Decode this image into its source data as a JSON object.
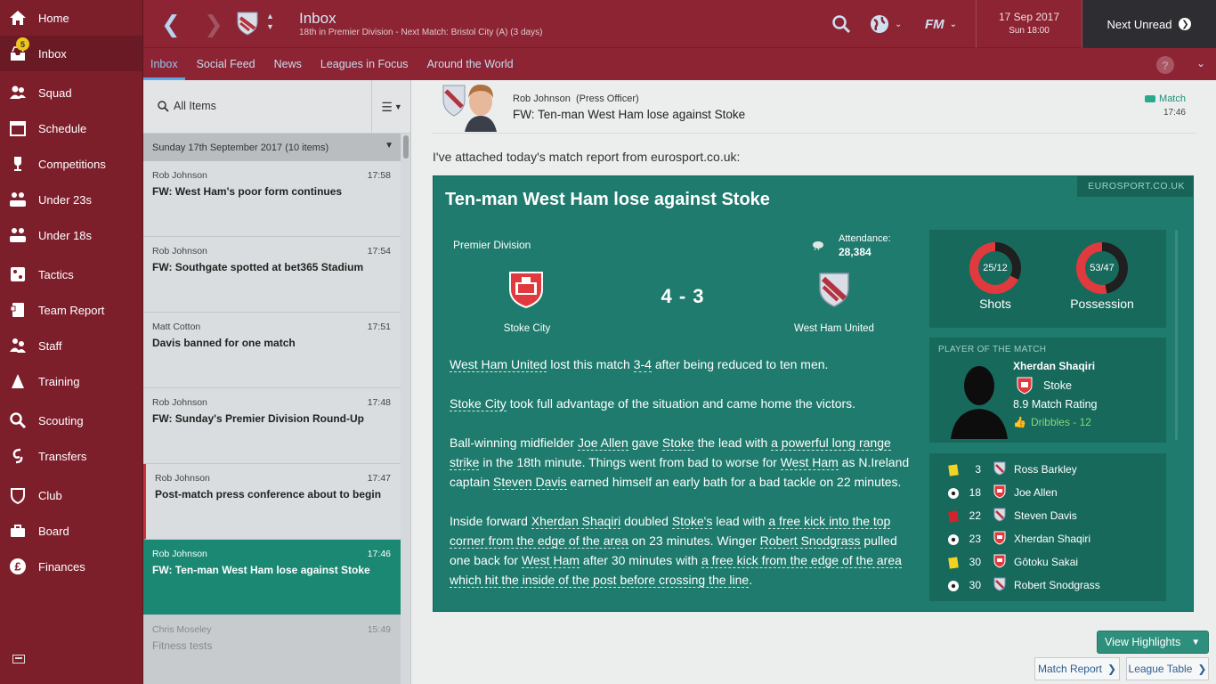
{
  "sidebar": {
    "items": [
      {
        "label": "Home",
        "icon": "home-icon"
      },
      {
        "label": "Inbox",
        "icon": "inbox-icon",
        "badge": "5",
        "active": true
      },
      {
        "label": "Squad",
        "icon": "squad-icon"
      },
      {
        "label": "Schedule",
        "icon": "calendar-icon"
      },
      {
        "label": "Competitions",
        "icon": "trophy-icon"
      },
      {
        "label": "Under 23s",
        "icon": "u23-icon"
      },
      {
        "label": "Under 18s",
        "icon": "u18-icon"
      },
      {
        "label": "Tactics",
        "icon": "tactics-icon"
      },
      {
        "label": "Team Report",
        "icon": "report-icon"
      },
      {
        "label": "Staff",
        "icon": "staff-icon"
      },
      {
        "label": "Training",
        "icon": "training-icon"
      },
      {
        "label": "Scouting",
        "icon": "search-icon"
      },
      {
        "label": "Transfers",
        "icon": "transfers-icon"
      },
      {
        "label": "Club",
        "icon": "club-icon"
      },
      {
        "label": "Board",
        "icon": "board-icon"
      },
      {
        "label": "Finances",
        "icon": "pound-icon"
      }
    ]
  },
  "header": {
    "title": "Inbox",
    "subtitle": "18th in Premier Division - Next Match: Bristol City (A) (3 days)",
    "date": "17 Sep 2017",
    "time": "Sun 18:00",
    "next_unread": "Next Unread",
    "fm_label": "FM"
  },
  "tabs": [
    {
      "label": "Inbox",
      "active": true
    },
    {
      "label": "Social Feed"
    },
    {
      "label": "News"
    },
    {
      "label": "Leagues in Focus"
    },
    {
      "label": "Around the World"
    }
  ],
  "help_label": "?",
  "list": {
    "filter_label": "All Items",
    "group_label": "Sunday 17th September 2017 (10 items)",
    "messages": [
      {
        "from": "Rob Johnson",
        "time": "17:58",
        "subject": "FW: West Ham's poor form continues"
      },
      {
        "from": "Rob Johnson",
        "time": "17:54",
        "subject": "FW: Southgate spotted at bet365 Stadium"
      },
      {
        "from": "Matt Cotton",
        "time": "17:51",
        "subject": "Davis banned for one match"
      },
      {
        "from": "Rob Johnson",
        "time": "17:48",
        "subject": "FW: Sunday's Premier Division Round-Up"
      },
      {
        "from": "Rob Johnson",
        "time": "17:47",
        "subject": "Post-match press conference about to begin"
      },
      {
        "from": "Rob Johnson",
        "time": "17:46",
        "subject": "FW: Ten-man West Ham lose against Stoke"
      },
      {
        "from": "Chris Moseley",
        "time": "15:49",
        "subject": "Fitness tests"
      }
    ]
  },
  "message": {
    "sender": "Rob Johnson",
    "sender_role": "(Press Officer)",
    "subject": "FW: Ten-man West Ham lose against Stoke",
    "tag": "Match",
    "time": "17:46",
    "intro": "I've attached today's match report from eurosport.co.uk:"
  },
  "report": {
    "source": "EUROSPORT.CO.UK",
    "title": "Ten-man West Ham lose against Stoke",
    "competition": "Premier Division",
    "attendance_label": "Attendance:",
    "attendance": "28,384",
    "home_team": "Stoke City",
    "away_team": "West Ham United",
    "score": "4 - 3",
    "paragraphs": [
      {
        "p1": "West Ham United",
        "p2": " lost this match ",
        "p3": "3-4",
        "p4": " after being reduced to ten men."
      },
      {
        "p1": "Stoke City",
        "p2": " took full advantage of the situation and came home the victors."
      },
      {
        "p1": "Ball-winning midfielder ",
        "p2": "Joe Allen",
        "p3": " gave ",
        "p4": "Stoke",
        "p5": " the lead with ",
        "p6": "a powerful long range strike",
        "p7": " in the 18th minute. Things went from bad to worse for ",
        "p8": "West Ham",
        "p9": " as N.Ireland captain ",
        "p10": "Steven Davis",
        "p11": " earned himself an early bath for a bad tackle on 22 minutes."
      },
      {
        "p1": "Inside forward ",
        "p2": "Xherdan Shaqiri",
        "p3": " doubled ",
        "p4": "Stoke's",
        "p5": " lead with ",
        "p6": "a free kick into the top corner from the edge of the area",
        "p7": " on 23 minutes. Winger ",
        "p8": "Robert Snodgrass",
        "p9": " pulled one back for ",
        "p10": "West Ham",
        "p11": " after 30 minutes with ",
        "p12": "a free kick from the edge of the area which hit the inside of the post before crossing the line",
        "p13": "."
      }
    ]
  },
  "stats": {
    "shots": {
      "label": "Shots",
      "value": "25/12",
      "home": 25,
      "away": 12
    },
    "possession": {
      "label": "Possession",
      "value": "53/47",
      "home": 53,
      "away": 47
    },
    "home_color": "#e03a3e",
    "away_color": "#1f1f1f"
  },
  "potm": {
    "title": "PLAYER OF THE MATCH",
    "name": "Xherdan Shaqiri",
    "club": "Stoke",
    "rating": "8.9 Match Rating",
    "stat": "Dribbles - 12"
  },
  "events": [
    {
      "type": "yellow-card",
      "minute": "3",
      "team": "away",
      "player": "Ross Barkley"
    },
    {
      "type": "goal",
      "minute": "18",
      "team": "home",
      "player": "Joe Allen"
    },
    {
      "type": "red-card",
      "minute": "22",
      "team": "away",
      "player": "Steven Davis"
    },
    {
      "type": "goal",
      "minute": "23",
      "team": "home",
      "player": "Xherdan Shaqiri"
    },
    {
      "type": "yellow-card",
      "minute": "30",
      "team": "home",
      "player": "Gôtoku Sakai"
    },
    {
      "type": "goal",
      "minute": "30",
      "team": "away",
      "player": "Robert Snodgrass"
    }
  ],
  "buttons": {
    "view_highlights": "View Highlights",
    "match_report": "Match Report",
    "league_table": "League Table"
  }
}
